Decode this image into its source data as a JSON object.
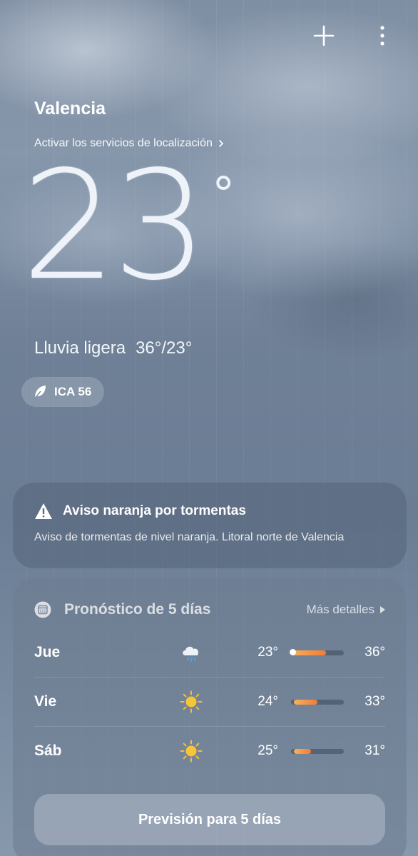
{
  "header": {
    "add_icon": "plus-icon",
    "menu_icon": "more-vertical-icon"
  },
  "location": {
    "city": "Valencia",
    "services_link": "Activar los servicios de localización"
  },
  "current": {
    "temperature": "23",
    "unit": "°",
    "condition": "Lluvia ligera",
    "high_low": "36°/23°"
  },
  "aqi": {
    "label": "ICA 56",
    "icon": "leaf-icon"
  },
  "alert": {
    "icon": "warning-icon",
    "title": "Aviso naranja por tormentas",
    "description": "Aviso de tormentas de nivel naranja. Litoral norte de Valencia"
  },
  "forecast": {
    "icon": "calendar-icon",
    "title": "Pronóstico de 5 días",
    "more_label": "Más detalles",
    "button_label": "Previsión para 5 días",
    "bar_colors": [
      "#f6b25a",
      "#f07b3a"
    ],
    "days": [
      {
        "name": "Jue",
        "icon": "rain-cloud-icon",
        "low": "23°",
        "high": "36°",
        "range_start": 0.0,
        "range_end": 0.66,
        "current_marker": true
      },
      {
        "name": "Vie",
        "icon": "sun-icon",
        "low": "24°",
        "high": "33°",
        "range_start": 0.05,
        "range_end": 0.5,
        "current_marker": false
      },
      {
        "name": "Sáb",
        "icon": "sun-icon",
        "low": "25°",
        "high": "31°",
        "range_start": 0.05,
        "range_end": 0.38,
        "current_marker": false
      }
    ]
  }
}
